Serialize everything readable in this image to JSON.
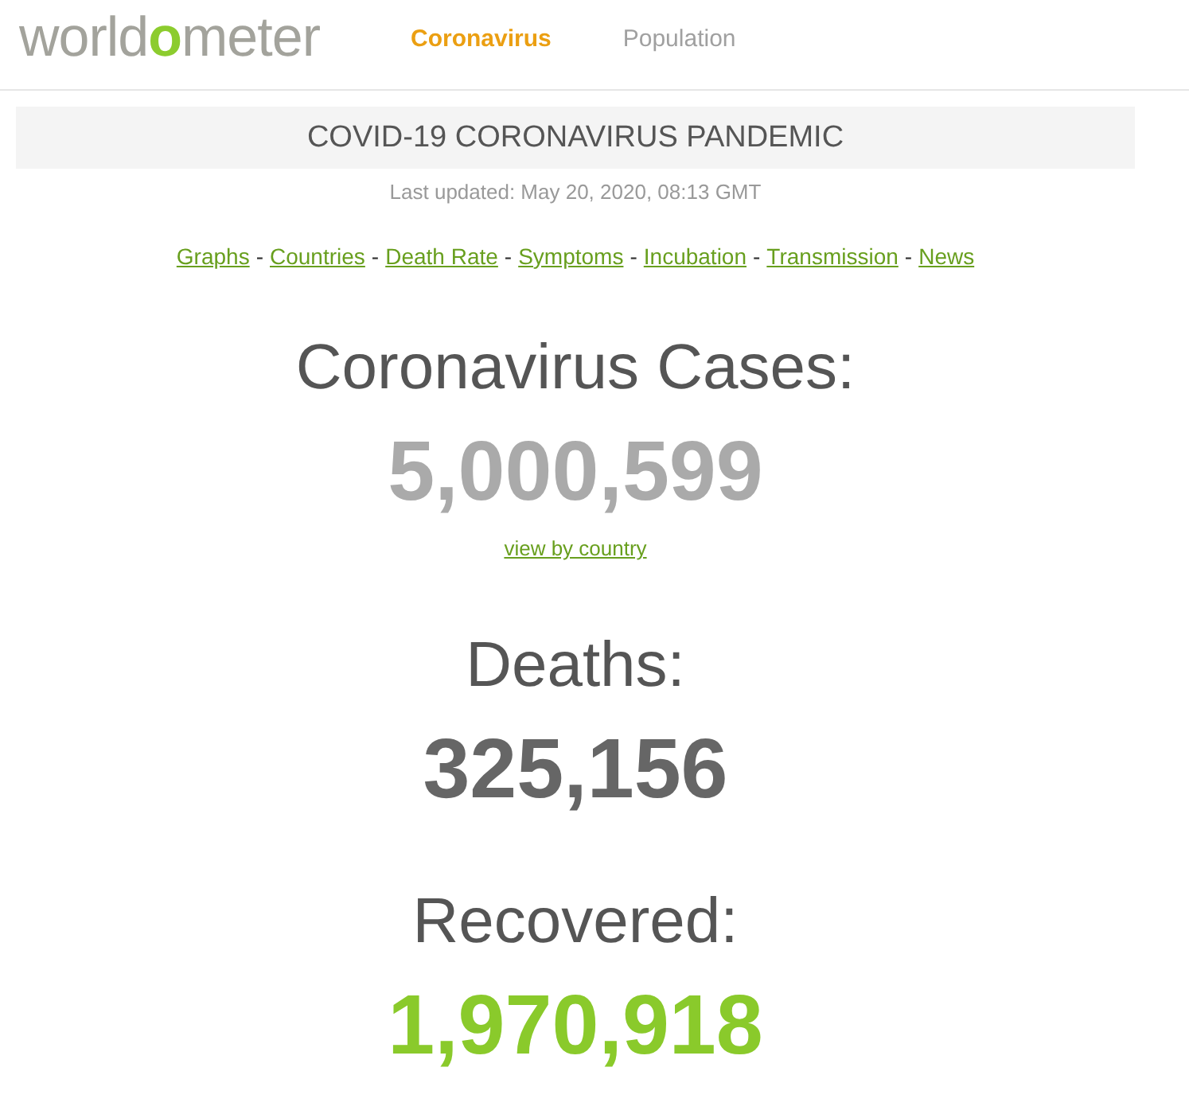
{
  "header": {
    "logo": {
      "parts": [
        {
          "text": "world",
          "accent": false
        },
        {
          "text": "o",
          "accent": true
        },
        {
          "text": "meter",
          "accent": false
        }
      ]
    },
    "nav": [
      {
        "label": "Coronavirus",
        "selected": true
      },
      {
        "label": "Population",
        "selected": false
      }
    ]
  },
  "banner": {
    "title": "COVID-19 CORONAVIRUS PANDEMIC",
    "last_updated": "Last updated: May 20, 2020, 08:13 GMT"
  },
  "quick_links": {
    "separator": "-",
    "items": [
      "Graphs",
      "Countries",
      "Death Rate",
      "Symptoms",
      "Incubation",
      "Transmission",
      "News"
    ]
  },
  "counters": [
    {
      "label": "Coronavirus Cases:",
      "value": "5,000,599",
      "color": "#aaaaaa",
      "link": "view by country"
    },
    {
      "label": "Deaths:",
      "value": "325,156",
      "color": "#666666"
    },
    {
      "label": "Recovered:",
      "value": "1,970,918",
      "color": "#8aca2b"
    }
  ]
}
